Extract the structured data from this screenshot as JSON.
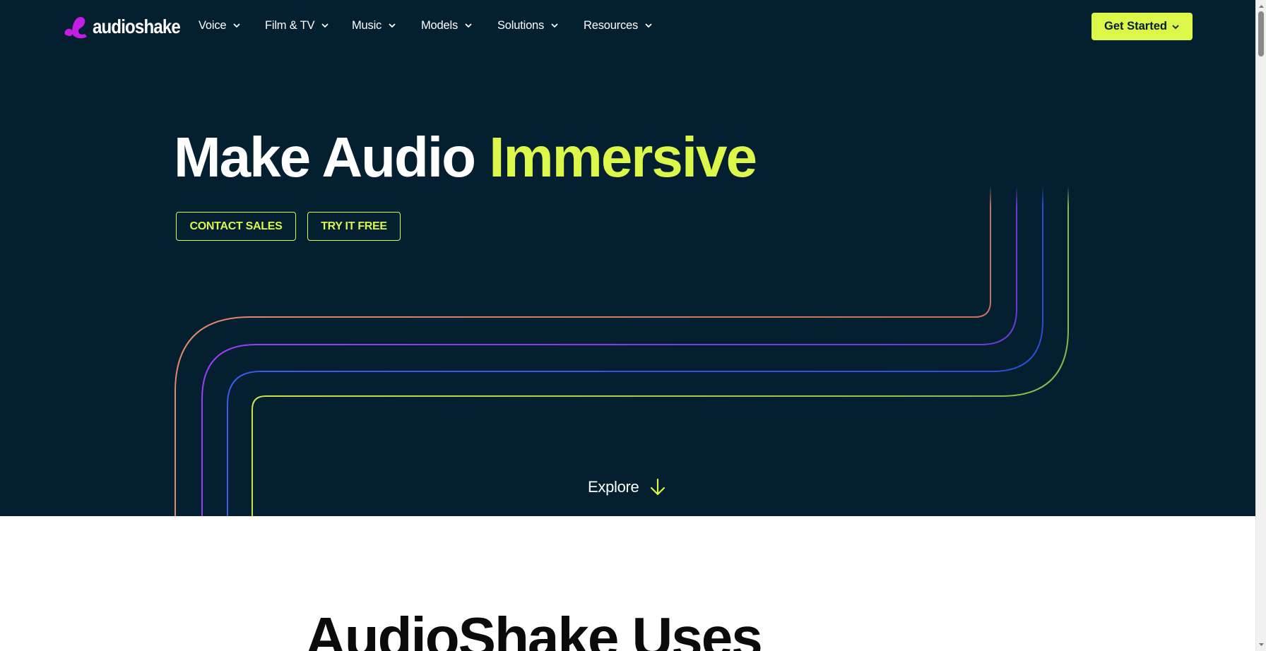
{
  "brand": {
    "name": "audioshake",
    "logo_color": "#c21ee6"
  },
  "nav": {
    "items": [
      {
        "label": "Voice"
      },
      {
        "label": "Film & TV"
      },
      {
        "label": "Music"
      },
      {
        "label": "Models"
      },
      {
        "label": "Solutions"
      },
      {
        "label": "Resources"
      }
    ],
    "cta_label": "Get Started"
  },
  "hero": {
    "headline_plain": "Make Audio",
    "headline_accent": "Immersive",
    "buttons": {
      "contact_sales": "CONTACT SALES",
      "try_free": "TRY IT FREE"
    },
    "explore_label": "Explore"
  },
  "section": {
    "title": "AudioShake Uses"
  },
  "colors": {
    "hero_bg": "#031f30",
    "accent": "#dcf64a",
    "line_orange": "#e07a5f",
    "line_purple": "#8a2be2",
    "line_blue": "#2f4fe0",
    "line_green": "#9cc94a"
  },
  "icons": [
    "chevron-down-icon",
    "arrow-down-icon",
    "audioshake-logo-icon"
  ]
}
